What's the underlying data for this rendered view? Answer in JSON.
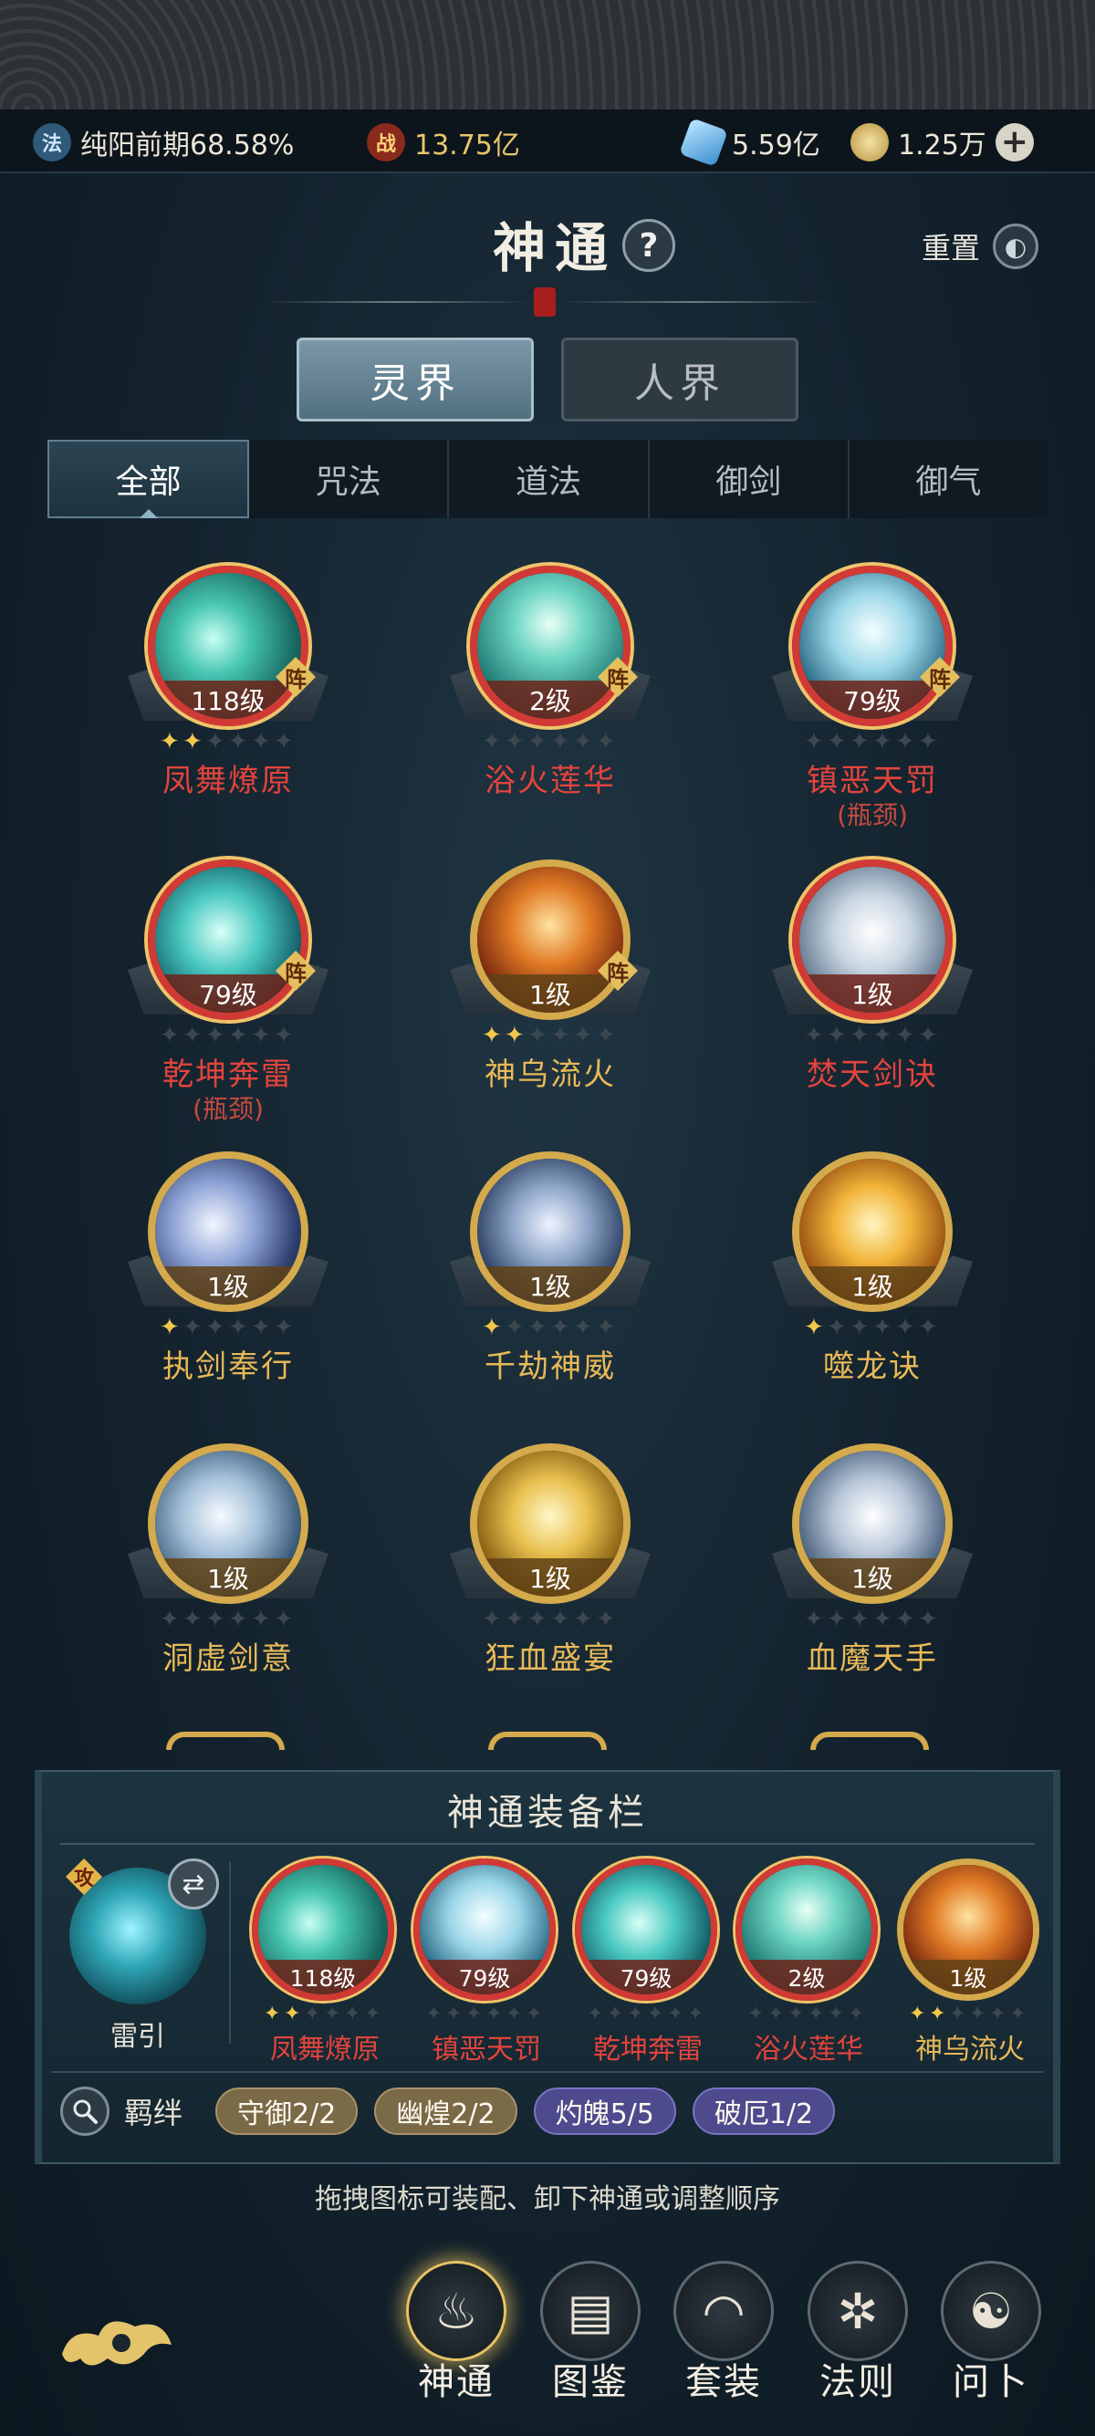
{
  "resources": {
    "cultivation": "纯阳前期68.58%",
    "cultivation_icon": "法",
    "power": "13.75亿",
    "power_icon": "战",
    "spirit_stone": "5.59亿",
    "gold_coin": "1.25万"
  },
  "header": {
    "title": "神通",
    "help": "?",
    "reset_label": "重置"
  },
  "realm_tabs": [
    {
      "label": "灵界",
      "active": true
    },
    {
      "label": "人界",
      "active": false
    }
  ],
  "category_tabs": [
    {
      "label": "全部",
      "active": true
    },
    {
      "label": "咒法",
      "active": false
    },
    {
      "label": "道法",
      "active": false
    },
    {
      "label": "御剑",
      "active": false
    },
    {
      "label": "御气",
      "active": false
    }
  ],
  "skills": [
    {
      "name": "凤舞燎原",
      "level": "118级",
      "tier": "red",
      "formation": "阵",
      "stars": 2,
      "note": ""
    },
    {
      "name": "浴火莲华",
      "level": "2级",
      "tier": "red",
      "formation": "阵",
      "stars": 0,
      "note": ""
    },
    {
      "name": "镇恶天罚",
      "level": "79级",
      "tier": "red",
      "formation": "阵",
      "stars": 0,
      "note": "(瓶颈)"
    },
    {
      "name": "乾坤奔雷",
      "level": "79级",
      "tier": "red",
      "formation": "阵",
      "stars": 0,
      "note": "(瓶颈)"
    },
    {
      "name": "神乌流火",
      "level": "1级",
      "tier": "gold",
      "formation": "阵",
      "stars": 2,
      "note": ""
    },
    {
      "name": "焚天剑诀",
      "level": "1级",
      "tier": "red",
      "formation": "",
      "stars": 0,
      "note": ""
    },
    {
      "name": "执剑奉行",
      "level": "1级",
      "tier": "gold",
      "formation": "",
      "stars": 1,
      "note": ""
    },
    {
      "name": "千劫神威",
      "level": "1级",
      "tier": "gold",
      "formation": "",
      "stars": 1,
      "note": ""
    },
    {
      "name": "噬龙诀",
      "level": "1级",
      "tier": "gold",
      "formation": "",
      "stars": 1,
      "note": ""
    },
    {
      "name": "洞虚剑意",
      "level": "1级",
      "tier": "gold",
      "formation": "",
      "stars": 0,
      "note": ""
    },
    {
      "name": "狂血盛宴",
      "level": "1级",
      "tier": "gold",
      "formation": "",
      "stars": 0,
      "note": ""
    },
    {
      "name": "血魔天手",
      "level": "1级",
      "tier": "gold",
      "formation": "",
      "stars": 0,
      "note": ""
    }
  ],
  "equip_panel": {
    "title": "神通装备栏",
    "main_skill": {
      "name": "雷引",
      "tag": "攻"
    },
    "slots": [
      {
        "name": "凤舞燎原",
        "level": "118级",
        "tier": "red",
        "stars": 2
      },
      {
        "name": "镇恶天罚",
        "level": "79级",
        "tier": "red",
        "stars": 0
      },
      {
        "name": "乾坤奔雷",
        "level": "79级",
        "tier": "red",
        "stars": 0
      },
      {
        "name": "浴火莲华",
        "level": "2级",
        "tier": "red",
        "stars": 0
      },
      {
        "name": "神乌流火",
        "level": "1级",
        "tier": "gold",
        "stars": 2
      }
    ],
    "bond_label": "羁绊",
    "bonds": [
      {
        "label": "守御2/2",
        "style": "tan"
      },
      {
        "label": "幽煌2/2",
        "style": "tan"
      },
      {
        "label": "灼魄5/5",
        "style": "purple"
      },
      {
        "label": "破厄1/2",
        "style": "purple"
      }
    ]
  },
  "hint": "拖拽图标可装配、卸下神通或调整顺序",
  "bottom_nav": [
    {
      "label": "神通",
      "icon": "flame-icon",
      "active": true
    },
    {
      "label": "图鉴",
      "icon": "book-icon",
      "active": false
    },
    {
      "label": "套装",
      "icon": "fan-icon",
      "active": false
    },
    {
      "label": "法则",
      "icon": "rune-icon",
      "active": false
    },
    {
      "label": "问卜",
      "icon": "divination-icon",
      "active": false
    }
  ],
  "colors": {
    "red_tier": "#d13a34",
    "gold_tier": "#d4aa4c",
    "red_name": "#e3443c",
    "gold_name": "#e8b957"
  }
}
